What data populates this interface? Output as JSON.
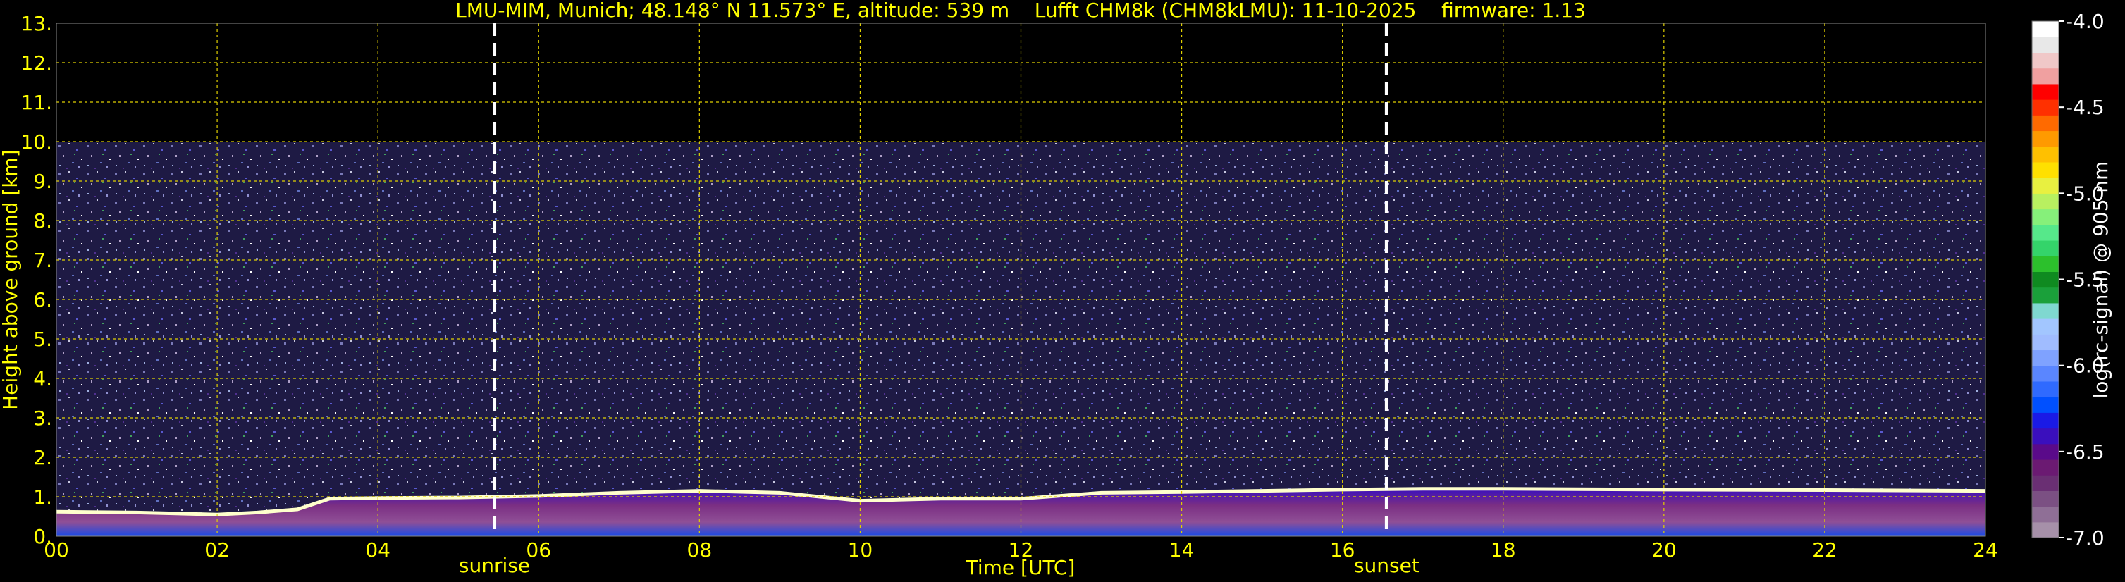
{
  "chart_data": {
    "type": "heatmap",
    "title": "LMU-MIM, Munich; 48.148° N 11.573° E, altitude: 539 m    Lufft CHM8k (CHM8kLMU): 11-10-2025    firmware: 1.13",
    "xlabel": "Time [UTC]",
    "ylabel": "Height above ground [km]",
    "xlim": [
      0,
      24
    ],
    "ylim": [
      0,
      13
    ],
    "x_ticks": [
      "00",
      "02",
      "04",
      "06",
      "08",
      "10",
      "12",
      "14",
      "16",
      "18",
      "20",
      "22",
      "24"
    ],
    "y_ticks": [
      "0.",
      "1.",
      "2.",
      "3.",
      "4.",
      "5.",
      "6.",
      "7.",
      "8.",
      "9.",
      "10.",
      "11.",
      "12.",
      "13."
    ],
    "grid": true,
    "data_top_km": 10.0,
    "annotations": [
      {
        "label": "sunrise",
        "time_h": 5.45
      },
      {
        "label": "sunset",
        "time_h": 16.55
      }
    ],
    "boundary_layer": [
      {
        "t": 0.0,
        "h": 0.62
      },
      {
        "t": 1.0,
        "h": 0.6
      },
      {
        "t": 2.0,
        "h": 0.55
      },
      {
        "t": 2.5,
        "h": 0.6
      },
      {
        "t": 3.0,
        "h": 0.68
      },
      {
        "t": 3.4,
        "h": 0.95
      },
      {
        "t": 4.0,
        "h": 0.97
      },
      {
        "t": 5.0,
        "h": 0.98
      },
      {
        "t": 6.0,
        "h": 1.02
      },
      {
        "t": 7.0,
        "h": 1.1
      },
      {
        "t": 8.0,
        "h": 1.15
      },
      {
        "t": 9.0,
        "h": 1.1
      },
      {
        "t": 10.0,
        "h": 0.9
      },
      {
        "t": 11.0,
        "h": 0.95
      },
      {
        "t": 12.0,
        "h": 0.95
      },
      {
        "t": 13.0,
        "h": 1.1
      },
      {
        "t": 14.0,
        "h": 1.12
      },
      {
        "t": 15.0,
        "h": 1.15
      },
      {
        "t": 16.0,
        "h": 1.18
      },
      {
        "t": 17.0,
        "h": 1.2
      },
      {
        "t": 18.0,
        "h": 1.2
      },
      {
        "t": 20.0,
        "h": 1.18
      },
      {
        "t": 22.0,
        "h": 1.17
      },
      {
        "t": 24.0,
        "h": 1.15
      }
    ],
    "colorbar": {
      "label": "log(rc-signal) @ 905 nm",
      "min": -7.0,
      "max": -4.0,
      "ticks": [
        "-4.0",
        "-4.5",
        "-5.0",
        "-5.5",
        "-6.0",
        "-6.5",
        "-7.0"
      ],
      "colors": [
        "#a690a9",
        "#8f6f96",
        "#7b5083",
        "#6a2f73",
        "#6b1a72",
        "#5a0a8a",
        "#3a0fbd",
        "#1a1ae6",
        "#0050ff",
        "#2f6aff",
        "#5a86ff",
        "#7fa2ff",
        "#a0bcff",
        "#a2c6ff",
        "#7fd8d0",
        "#1aa03a",
        "#0f8a20",
        "#2cc02c",
        "#34d46a",
        "#56e88a",
        "#86f07a",
        "#b8f060",
        "#e8f040",
        "#ffe000",
        "#ffc000",
        "#ff9a00",
        "#ff6a00",
        "#ff3000",
        "#ff0000",
        "#f0a0a0",
        "#f0c8c8",
        "#e8e8e8",
        "#ffffff"
      ]
    }
  },
  "colors": {
    "text": "#ffff00",
    "grid": "#e0d000",
    "background": "#000000",
    "noise_base": "#1e1a44"
  }
}
